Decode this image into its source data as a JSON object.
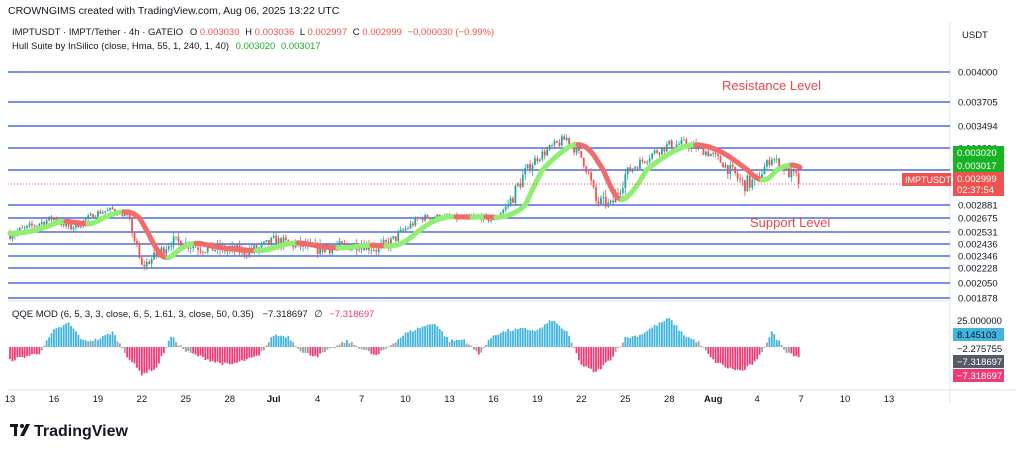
{
  "header": {
    "created_by": "CROWNGIMS created with TradingView.com, Aug 06, 2025 13:22 UTC"
  },
  "legend": {
    "symbol": "IMPTUSDT · IMPT/Tether · 4h · GATEIO",
    "o_label": "O",
    "o_value": "0.003030",
    "h_label": "H",
    "h_value": "0.003036",
    "l_label": "L",
    "l_value": "0.002997",
    "c_label": "C",
    "c_value": "0.002999",
    "change": "−0.000030 (−0.99%)",
    "hull_name": "Hull Suite by InSilico (close, Hma, 55, 1, 240, 1, 40)",
    "hull_v1": "0.003020",
    "hull_v2": "0.003017"
  },
  "qqe_legend": {
    "name": "QQE MOD (6, 5, 3, 3, close, 6, 5, 1.61, 3, close, 50, 0.35)",
    "v1": "−7.318697",
    "sym": "∅",
    "v2": "−7.318697"
  },
  "annotations": {
    "resistance": "Resistance Level",
    "support": "Support Level"
  },
  "price_axis": {
    "currency": "USDT",
    "ticks": [
      "0.004000",
      "0.003705",
      "0.003494",
      "0.003291",
      "0.003078",
      "0.002881",
      "0.002675",
      "0.002531",
      "0.002436",
      "0.002346",
      "0.002228",
      "0.002050",
      "0.001878"
    ],
    "hull_label_1": "0.003020",
    "hull_label_2": "0.003017",
    "price_tag_symbol": "IMPTUSDT",
    "price_tag_value": "0.002999",
    "price_tag_timer": "02:37:54"
  },
  "qqe_axis": {
    "ticks": [
      "25.000000",
      "−2.275755"
    ],
    "label_blue": "8.145103",
    "label_grey": "−7.318697",
    "label_red": "−7.318697"
  },
  "time_axis": {
    "labels": [
      "13",
      "16",
      "19",
      "22",
      "25",
      "28",
      "Jul",
      "4",
      "7",
      "10",
      "13",
      "16",
      "19",
      "22",
      "25",
      "28",
      "Aug",
      "4",
      "7",
      "10",
      "13"
    ]
  },
  "brand": {
    "name": "TradingView"
  },
  "colors": {
    "up": "#26a69a",
    "down": "#ef5350",
    "hull_up": "#90ee70",
    "hull_down": "#f26b6b",
    "level": "#2f4fd8",
    "qqe_blue": "#41b5e0",
    "qqe_red": "#ef3a7a",
    "qqe_grey": "#9e9e9e"
  },
  "chart_data": {
    "type": "candlestick",
    "interval": "4h",
    "ylim": [
      0.00178,
      0.00415
    ],
    "horizontal_levels": [
      0.004,
      0.003705,
      0.003494,
      0.003291,
      0.003078,
      0.002881,
      0.002675,
      0.002531,
      0.002436,
      0.002346,
      0.002228,
      0.00205,
      0.001878
    ],
    "price_path": [
      [
        "2025-06-13",
        0.00252
      ],
      [
        "2025-06-14",
        0.00256
      ],
      [
        "2025-06-15",
        0.00262
      ],
      [
        "2025-06-16",
        0.00268
      ],
      [
        "2025-06-17",
        0.00257
      ],
      [
        "2025-06-18",
        0.00264
      ],
      [
        "2025-06-19",
        0.00276
      ],
      [
        "2025-06-20",
        0.00281
      ],
      [
        "2025-06-21",
        0.0027
      ],
      [
        "2025-06-22",
        0.00224
      ],
      [
        "2025-06-23",
        0.00235
      ],
      [
        "2025-06-24",
        0.00246
      ],
      [
        "2025-06-25",
        0.00244
      ],
      [
        "2025-06-26",
        0.00241
      ],
      [
        "2025-06-27",
        0.0024
      ],
      [
        "2025-06-28",
        0.00239
      ],
      [
        "2025-06-29",
        0.00238
      ],
      [
        "2025-06-30",
        0.0024
      ],
      [
        "2025-07-01",
        0.00246
      ],
      [
        "2025-07-02",
        0.00244
      ],
      [
        "2025-07-03",
        0.00242
      ],
      [
        "2025-07-04",
        0.0024
      ],
      [
        "2025-07-05",
        0.00241
      ],
      [
        "2025-07-06",
        0.00242
      ],
      [
        "2025-07-07",
        0.00244
      ],
      [
        "2025-07-08",
        0.0024
      ],
      [
        "2025-07-09",
        0.00245
      ],
      [
        "2025-07-10",
        0.00256
      ],
      [
        "2025-07-11",
        0.00268
      ],
      [
        "2025-07-12",
        0.0027
      ],
      [
        "2025-07-13",
        0.00269
      ],
      [
        "2025-07-14",
        0.00268
      ],
      [
        "2025-07-15",
        0.00271
      ],
      [
        "2025-07-16",
        0.00265
      ],
      [
        "2025-07-17",
        0.00288
      ],
      [
        "2025-07-18",
        0.00304
      ],
      [
        "2025-07-19",
        0.0032
      ],
      [
        "2025-07-20",
        0.0033
      ],
      [
        "2025-07-21",
        0.00338
      ],
      [
        "2025-07-22",
        0.0032
      ],
      [
        "2025-07-23",
        0.0029
      ],
      [
        "2025-07-24",
        0.00287
      ],
      [
        "2025-07-25",
        0.00305
      ],
      [
        "2025-07-26",
        0.00315
      ],
      [
        "2025-07-27",
        0.00325
      ],
      [
        "2025-07-28",
        0.00332
      ],
      [
        "2025-07-29",
        0.00333
      ],
      [
        "2025-07-30",
        0.00329
      ],
      [
        "2025-07-31",
        0.00322
      ],
      [
        "2025-08-01",
        0.0031
      ],
      [
        "2025-08-02",
        0.003
      ],
      [
        "2025-08-03",
        0.00301
      ],
      [
        "2025-08-04",
        0.0032
      ],
      [
        "2025-08-05",
        0.00308
      ],
      [
        "2025-08-06",
        0.002999
      ]
    ],
    "qqe_histogram": [
      [
        "2025-06-13",
        -9
      ],
      [
        "2025-06-15",
        -4
      ],
      [
        "2025-06-16",
        11
      ],
      [
        "2025-06-17",
        16
      ],
      [
        "2025-06-18",
        4
      ],
      [
        "2025-06-19",
        5
      ],
      [
        "2025-06-20",
        10
      ],
      [
        "2025-06-21",
        -6
      ],
      [
        "2025-06-22",
        -18
      ],
      [
        "2025-06-23",
        -14
      ],
      [
        "2025-06-24",
        7
      ],
      [
        "2025-06-25",
        -3
      ],
      [
        "2025-06-27",
        -10
      ],
      [
        "2025-06-28",
        -12
      ],
      [
        "2025-06-30",
        -6
      ],
      [
        "2025-07-01",
        8
      ],
      [
        "2025-07-02",
        7
      ],
      [
        "2025-07-03",
        -4
      ],
      [
        "2025-07-04",
        -6
      ],
      [
        "2025-07-06",
        4
      ],
      [
        "2025-07-08",
        -6
      ],
      [
        "2025-07-10",
        9
      ],
      [
        "2025-07-11",
        13
      ],
      [
        "2025-07-12",
        16
      ],
      [
        "2025-07-13",
        4
      ],
      [
        "2025-07-14",
        5
      ],
      [
        "2025-07-15",
        -5
      ],
      [
        "2025-07-16",
        8
      ],
      [
        "2025-07-17",
        11
      ],
      [
        "2025-07-18",
        12
      ],
      [
        "2025-07-19",
        11
      ],
      [
        "2025-07-20",
        18
      ],
      [
        "2025-07-21",
        10
      ],
      [
        "2025-07-22",
        -12
      ],
      [
        "2025-07-23",
        -17
      ],
      [
        "2025-07-24",
        -8
      ],
      [
        "2025-07-25",
        6
      ],
      [
        "2025-07-26",
        8
      ],
      [
        "2025-07-27",
        14
      ],
      [
        "2025-07-28",
        19
      ],
      [
        "2025-07-29",
        8
      ],
      [
        "2025-07-30",
        3
      ],
      [
        "2025-07-31",
        -9
      ],
      [
        "2025-08-01",
        -14
      ],
      [
        "2025-08-02",
        -16
      ],
      [
        "2025-08-03",
        -9
      ],
      [
        "2025-08-04",
        10
      ],
      [
        "2025-08-05",
        -3
      ],
      [
        "2025-08-06",
        -7.3
      ]
    ]
  }
}
